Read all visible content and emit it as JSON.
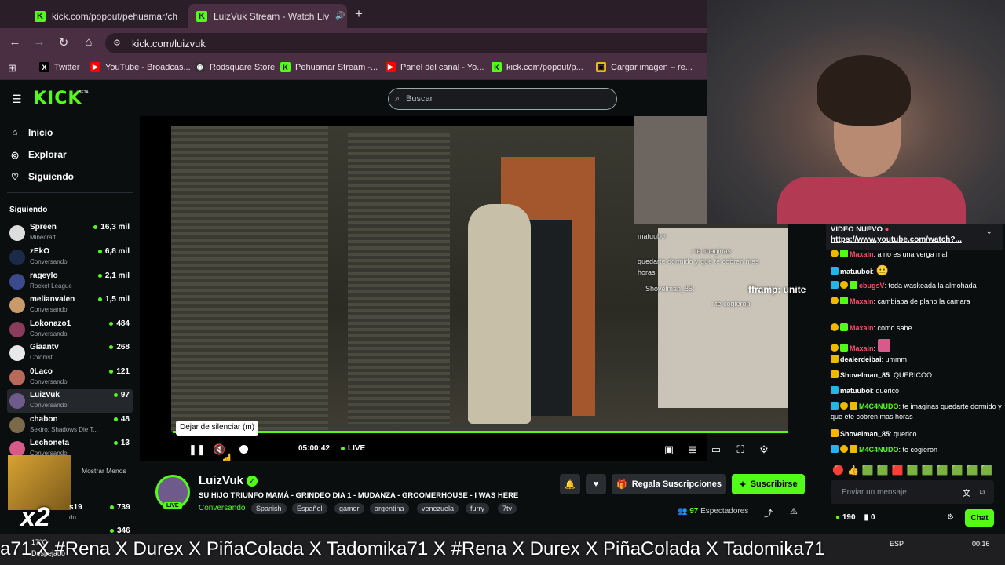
{
  "browser": {
    "tabs": [
      {
        "title": "kick.com/popout/pehuamar/ch",
        "active": false
      },
      {
        "title": "LuizVuk Stream - Watch Liv",
        "active": true
      }
    ],
    "url": "kick.com/luizvuk",
    "bookmarks": [
      "Twitter",
      "YouTube - Broadcas...",
      "Rodsquare Store",
      "Pehuamar Stream -...",
      "Panel del canal - Yo...",
      "kick.com/popout/p...",
      "Cargar imagen – re..."
    ]
  },
  "kick": {
    "search_placeholder": "Buscar",
    "beta": "BETA",
    "nav": [
      "Inicio",
      "Explorar",
      "Siguiendo"
    ],
    "following_title": "Siguiendo",
    "channels": [
      {
        "name": "Spreen",
        "sub": "Minecraft",
        "viewers": "16,3 mil"
      },
      {
        "name": "zEkO",
        "sub": "Conversando",
        "viewers": "6,8 mil"
      },
      {
        "name": "rageylo",
        "sub": "Rocket League",
        "viewers": "2,1 mil"
      },
      {
        "name": "melianvalen",
        "sub": "Conversando",
        "viewers": "1,5 mil"
      },
      {
        "name": "Lokonazo1",
        "sub": "Conversando",
        "viewers": "484"
      },
      {
        "name": "Giaantv",
        "sub": "Colonist",
        "viewers": "268"
      },
      {
        "name": "0Laco",
        "sub": "Conversando",
        "viewers": "121"
      },
      {
        "name": "LuizVuk",
        "sub": "Conversando",
        "viewers": "97"
      },
      {
        "name": "chabon",
        "sub": "Sekiro: Shadows Die T...",
        "viewers": "48"
      },
      {
        "name": "Lechoneta",
        "sub": "Conversando",
        "viewers": "13"
      }
    ],
    "show_less": "Mostrar Menos",
    "partial_rows": [
      {
        "name": "s19",
        "sub": "do",
        "viewers": "739"
      },
      {
        "name": "...",
        "sub": "",
        "viewers": "346"
      }
    ]
  },
  "player": {
    "tooltip": "Dejar de silenciar (m)",
    "time": "05:00:42",
    "live": "LIVE",
    "overlay_lines": [
      "matuubo:",
      ": te imaginas",
      "quedarte dormido y que te cobren mas",
      "horas",
      "Shovelman_85:",
      ": te cogieron"
    ],
    "overlay_name": "fframp: unite"
  },
  "stream": {
    "streamer": "LuizVuk",
    "title": "SU HIJO TRIUNFO MAMÁ - GRINDEO DIA 1 - MUDANZA - GROOMERHOUSE - I WAS HERE",
    "category": "Conversando",
    "tags": [
      "Spanish",
      "Español",
      "gamer",
      "argentina",
      "venezuela",
      "furry",
      "7tv"
    ],
    "gift": "Regala Suscripciones",
    "subscribe": "Suscribirse",
    "viewers": "97",
    "viewers_label": "Espectadores",
    "live_pill": "LIVE"
  },
  "chat": {
    "pinned_title": "VIDEO NUEVO",
    "pinned_link": "https://www.youtube.com/watch?...",
    "messages": [
      {
        "user": "Maxain",
        "text": ": a no es una verga mal",
        "color": "#ff4d6a"
      },
      {
        "user": "matuuboi",
        "text": ":",
        "color": "#ffffff"
      },
      {
        "user": "cbugsV",
        "text": ": toda waskeada la almohada",
        "color": "#ff4d6a"
      },
      {
        "user": "Maxain",
        "text": ": cambiaba de plano la camara",
        "color": "#ff4d6a"
      },
      {
        "user": "Maxain",
        "text": ": como sabe",
        "color": "#ff4d6a"
      },
      {
        "user": "Maxain",
        "text": ":",
        "color": "#ff4d6a"
      },
      {
        "user": "dealerdeibai",
        "text": ": ummm",
        "color": "#ffffff"
      },
      {
        "user": "Shovelman_85",
        "text": ": QUERICOO",
        "color": "#ffffff"
      },
      {
        "user": "matuuboi",
        "text": ": querico",
        "color": "#ffffff"
      },
      {
        "user": "M4C4NUDO",
        "text": ": te imaginas quedarte dormido y que ete cobren mas horas",
        "color": "#53fc18"
      },
      {
        "user": "Shovelman_85",
        "text": ": querico",
        "color": "#ffffff"
      },
      {
        "user": "M4C4NUDO",
        "text": ": te cogieron",
        "color": "#53fc18"
      }
    ],
    "input_placeholder": "Enviar un mensaje",
    "points": "190",
    "count": "0",
    "chat_button": "Chat"
  },
  "taskbar": {
    "marquee": "a71 X #Rena X Durex X PiñaColada X Tadomika71 X #Rena X Durex X PiñaColada X Tadomika71",
    "weather": "17°C",
    "weather_sub": "Despejado",
    "lang": "ESP",
    "time": "00:16",
    "x2": "x2"
  },
  "colors": {
    "accent": "#53fc18",
    "background": "#0b0e0f",
    "tab_active": "#4a2f43"
  }
}
